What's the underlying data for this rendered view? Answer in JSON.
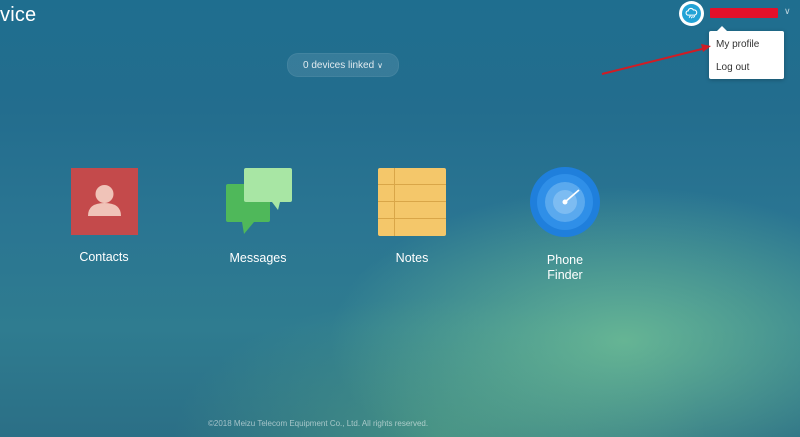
{
  "header": {
    "brand_partial": "vice",
    "devices_pill": {
      "label": "0 devices linked",
      "chevron": "∨"
    },
    "user": {
      "avatar_icon": "cloud-icon",
      "chevron": "∨",
      "redaction_color": "#e3102a"
    },
    "user_menu": {
      "items": [
        "My profile",
        "Log out"
      ]
    }
  },
  "apps": [
    {
      "label": "Contacts",
      "icon": "contacts-icon",
      "color": "#c44a4b"
    },
    {
      "label": "Messages",
      "icon": "messages-icon",
      "color": "#4fb85a"
    },
    {
      "label": "Notes",
      "icon": "notes-icon",
      "color": "#f4c76a"
    },
    {
      "label": "Phone\nFinder",
      "icon": "phone-finder-icon",
      "color": "#2f8fe8"
    }
  ],
  "annotation": {
    "arrow_color": "#d01c24"
  },
  "footer": {
    "copyright": "©2018 Meizu Telecom Equipment Co., Ltd. All rights reserved."
  }
}
